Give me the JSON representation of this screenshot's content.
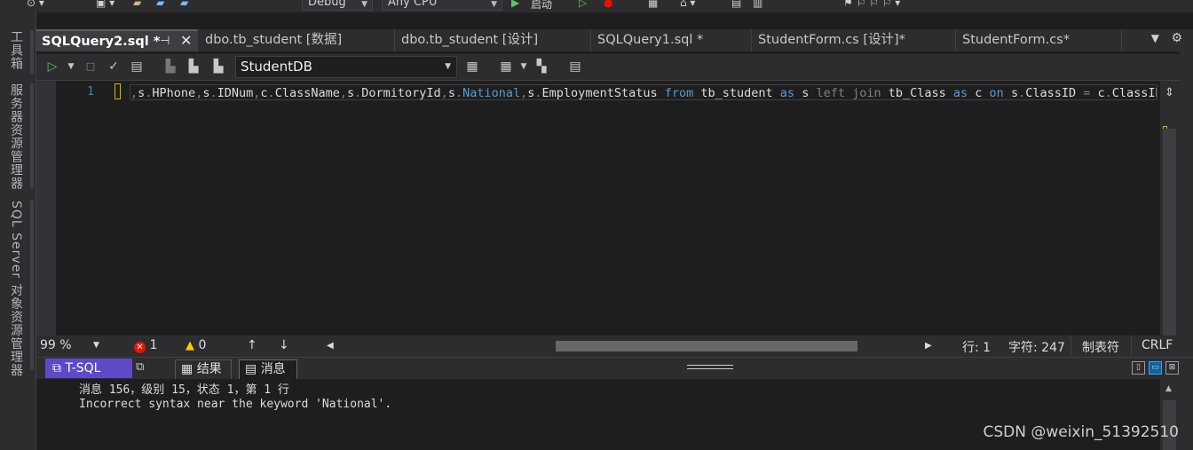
{
  "toolbar": {
    "config": "Debug",
    "platform": "Any CPU",
    "start_label": "启动"
  },
  "side_panels": [
    {
      "label": "工具箱"
    },
    {
      "label": "服务器资源管理器"
    },
    {
      "label": "SQL Server 对象资源管理器"
    }
  ],
  "tabs": [
    {
      "label": "SQLQuery2.sql *",
      "active": true
    },
    {
      "label": "dbo.tb_student [数据]"
    },
    {
      "label": "dbo.tb_student [设计]"
    },
    {
      "label": "SQLQuery1.sql *"
    },
    {
      "label": "StudentForm.cs [设计]*"
    },
    {
      "label": "StudentForm.cs*"
    }
  ],
  "query_toolbar": {
    "database": "StudentDB"
  },
  "editor": {
    "line_number": "1",
    "tokens": [
      {
        "t": ",",
        "c": "op"
      },
      {
        "t": "s",
        "c": "id"
      },
      {
        "t": ".",
        "c": "op"
      },
      {
        "t": "HPhone",
        "c": "id"
      },
      {
        "t": ",",
        "c": "op"
      },
      {
        "t": "s",
        "c": "id"
      },
      {
        "t": ".",
        "c": "op"
      },
      {
        "t": "IDNum",
        "c": "id"
      },
      {
        "t": ",",
        "c": "op"
      },
      {
        "t": "c",
        "c": "id"
      },
      {
        "t": ".",
        "c": "op"
      },
      {
        "t": "ClassName",
        "c": "id"
      },
      {
        "t": ",",
        "c": "op"
      },
      {
        "t": "s",
        "c": "id"
      },
      {
        "t": ".",
        "c": "op"
      },
      {
        "t": "DormitoryId",
        "c": "id"
      },
      {
        "t": ",",
        "c": "op"
      },
      {
        "t": "s",
        "c": "id"
      },
      {
        "t": ".",
        "c": "op"
      },
      {
        "t": "National",
        "c": "err"
      },
      {
        "t": ",",
        "c": "op"
      },
      {
        "t": "s",
        "c": "id"
      },
      {
        "t": ".",
        "c": "op"
      },
      {
        "t": "EmploymentStatus",
        "c": "id"
      },
      {
        "t": " ",
        "c": "id"
      },
      {
        "t": "from",
        "c": "kw"
      },
      {
        "t": " tb_student ",
        "c": "id"
      },
      {
        "t": "as",
        "c": "kw"
      },
      {
        "t": " s ",
        "c": "id"
      },
      {
        "t": "left join",
        "c": "op"
      },
      {
        "t": " tb_Class ",
        "c": "id"
      },
      {
        "t": "as",
        "c": "kw"
      },
      {
        "t": " c ",
        "c": "id"
      },
      {
        "t": "on",
        "c": "kw"
      },
      {
        "t": " s",
        "c": "id"
      },
      {
        "t": ".",
        "c": "op"
      },
      {
        "t": "ClassID ",
        "c": "id"
      },
      {
        "t": "=",
        "c": "op"
      },
      {
        "t": " c",
        "c": "id"
      },
      {
        "t": ".",
        "c": "op"
      },
      {
        "t": "ClassID",
        "c": "id"
      }
    ]
  },
  "status": {
    "zoom": "99 %",
    "errors": "1",
    "warnings": "0",
    "line": "行: 1",
    "char": "字符: 247",
    "tabs_mode": "制表符",
    "line_ending": "CRLF"
  },
  "results": {
    "mode": "T-SQL",
    "tab_results": "结果",
    "tab_messages": "消息",
    "messages": [
      "消息 156，级别 15，状态 1，第 1 行",
      "Incorrect syntax near the keyword 'National'."
    ]
  },
  "watermark": "CSDN @weixin_51392510",
  "colors": {
    "background": "#1e1e1e",
    "chrome": "#2d2d30",
    "keyword": "#569cd6",
    "error": "#e51400",
    "tsql_tab": "#5e49c9"
  }
}
